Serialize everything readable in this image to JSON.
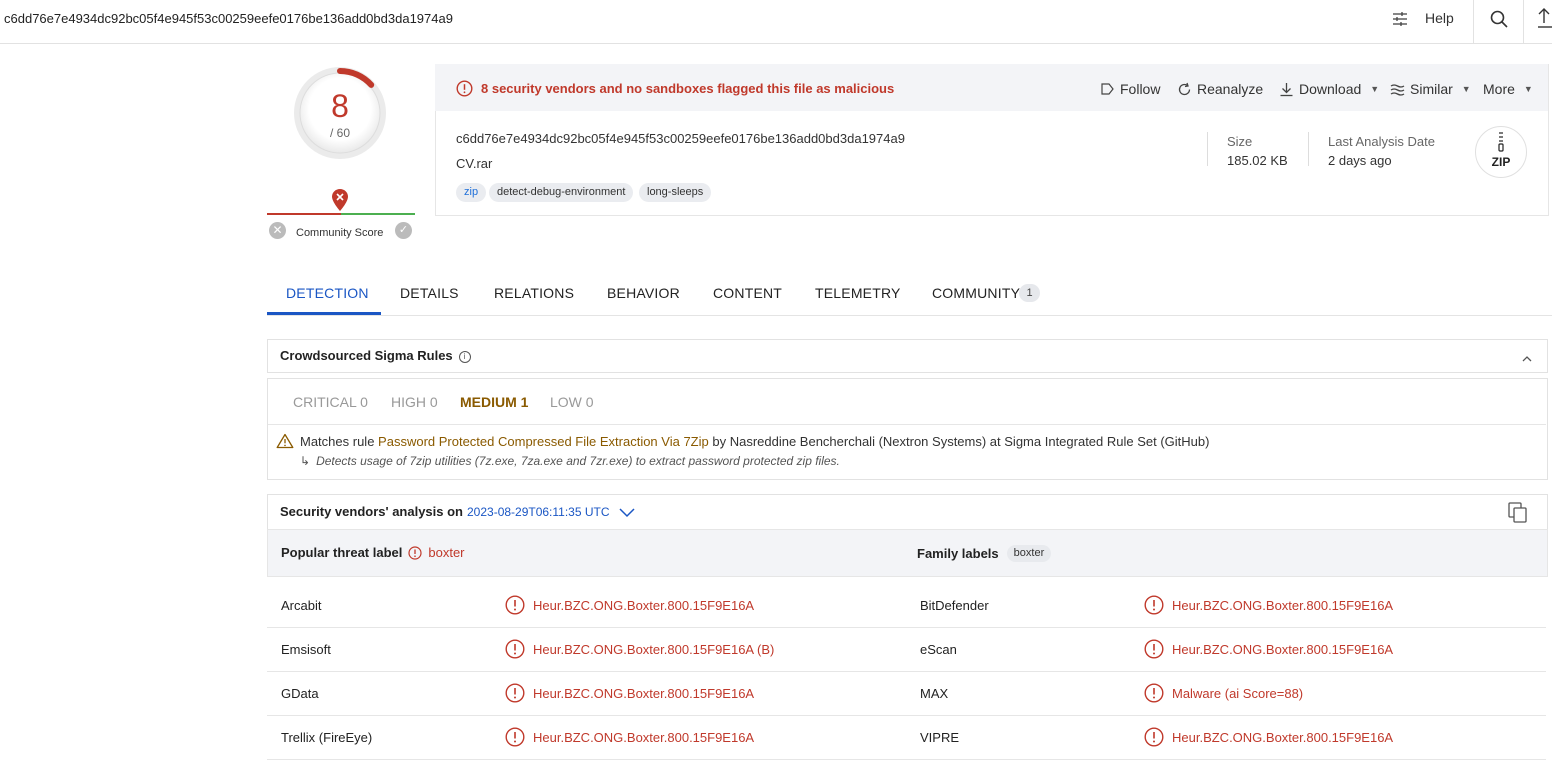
{
  "topbar": {
    "hash": "c6dd76e7e4934dc92bc05f4e945f53c00259eefe0176be136add0bd3da1974a9",
    "help": "Help"
  },
  "score": {
    "detections": "8",
    "total": "/ 60",
    "detection_fraction": 0.1333,
    "community_label": "Community Score"
  },
  "header": {
    "alert": "8 security vendors and no sandboxes flagged this file as malicious",
    "actions": {
      "follow": "Follow",
      "reanalyze": "Reanalyze",
      "download": "Download",
      "similar": "Similar",
      "more": "More"
    },
    "file_hash": "c6dd76e7e4934dc92bc05f4e945f53c00259eefe0176be136add0bd3da1974a9",
    "file_name": "CV.rar",
    "tags": [
      "zip",
      "detect-debug-environment",
      "long-sleeps"
    ],
    "size_label": "Size",
    "size_value": "185.02 KB",
    "last_analysis_label": "Last Analysis Date",
    "last_analysis_value": "2 days ago",
    "file_type": "ZIP"
  },
  "tabs": [
    {
      "label": "DETECTION"
    },
    {
      "label": "DETAILS"
    },
    {
      "label": "RELATIONS"
    },
    {
      "label": "BEHAVIOR"
    },
    {
      "label": "CONTENT"
    },
    {
      "label": "TELEMETRY"
    },
    {
      "label": "COMMUNITY"
    }
  ],
  "community_count": "1",
  "sigma": {
    "title": "Crowdsourced Sigma Rules",
    "severities": [
      "CRITICAL 0",
      "HIGH 0",
      "MEDIUM 1",
      "LOW 0"
    ],
    "rule_prefix": "Matches rule",
    "rule_name": "Password Protected Compressed File Extraction Via 7Zip",
    "rule_suffix": "by Nasreddine Bencherchali (Nextron Systems) at Sigma Integrated Rule Set (GitHub)",
    "rule_description": "Detects usage of 7zip utilities (7z.exe, 7za.exe and 7zr.exe) to extract password protected zip files."
  },
  "vendors": {
    "title": "Security vendors' analysis on",
    "date": "2023-08-29T06:11:35 UTC",
    "popular_threat_label": "Popular threat label",
    "threat_value": "boxter",
    "family_labels": "Family labels",
    "family_value": "boxter",
    "rows": [
      {
        "v1": "Arcabit",
        "r1": "Heur.BZC.ONG.Boxter.800.15F9E16A",
        "v2": "BitDefender",
        "r2": "Heur.BZC.ONG.Boxter.800.15F9E16A"
      },
      {
        "v1": "Emsisoft",
        "r1": "Heur.BZC.ONG.Boxter.800.15F9E16A (B)",
        "v2": "eScan",
        "r2": "Heur.BZC.ONG.Boxter.800.15F9E16A"
      },
      {
        "v1": "GData",
        "r1": "Heur.BZC.ONG.Boxter.800.15F9E16A",
        "v2": "MAX",
        "r2": "Malware (ai Score=88)"
      },
      {
        "v1": "Trellix (FireEye)",
        "r1": "Heur.BZC.ONG.Boxter.800.15F9E16A",
        "v2": "VIPRE",
        "r2": "Heur.BZC.ONG.Boxter.800.15F9E16A"
      }
    ]
  },
  "colors": {
    "malicious": "#c0392b",
    "accent": "#1a56c4",
    "medium": "#8a5a00"
  }
}
